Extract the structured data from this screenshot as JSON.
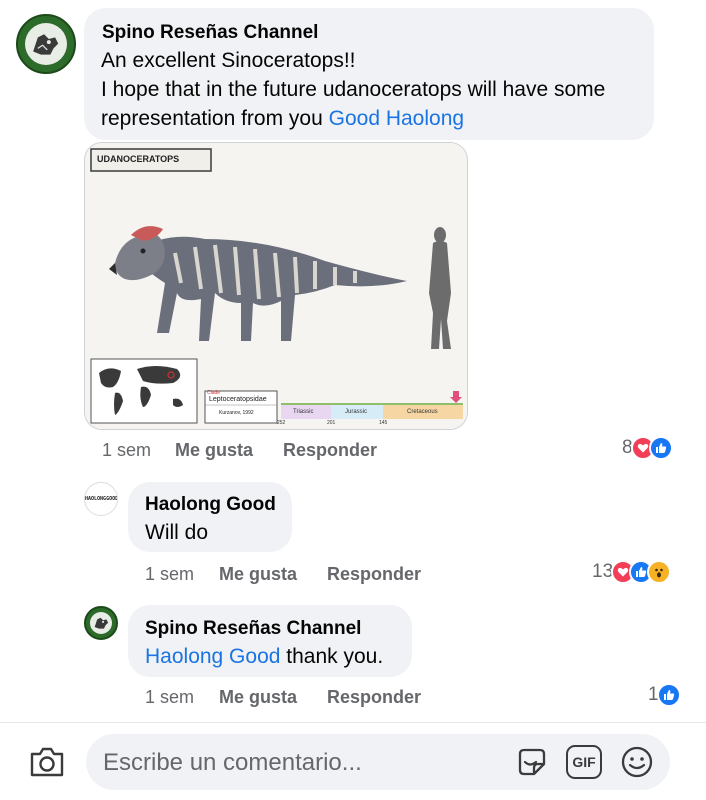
{
  "comments": [
    {
      "author": "Spino Reseñas Channel",
      "lines": [
        "An excellent Sinoceratops!!",
        "I hope that in the future udanoceratops will have some"
      ],
      "line3_prefix": "representation from you ",
      "line3_mention": "Good Haolong",
      "time": "1 sem",
      "like_label": "Me gusta",
      "reply_label": "Responder",
      "reaction_count": "8",
      "reaction_types": [
        "love",
        "like"
      ]
    },
    {
      "author": "Haolong Good",
      "avatar_text": "HAOLONGGOOD",
      "text": "Will do",
      "time": "1 sem",
      "like_label": "Me gusta",
      "reply_label": "Responder",
      "reaction_count": "13",
      "reaction_types": [
        "love",
        "like",
        "wow"
      ]
    },
    {
      "author": "Spino Reseñas Channel",
      "mention": "Haolong Good",
      "text_suffix": " thank you.",
      "time": "1 sem",
      "like_label": "Me gusta",
      "reply_label": "Responder",
      "reaction_count": "1",
      "reaction_types": [
        "like"
      ]
    }
  ],
  "attachment": {
    "title": "UDANOCERATOPS",
    "clade_label": "Clade",
    "clade": "Leptoceratopsidae",
    "author_year": "Kurzanov, 1992",
    "periods": [
      "Triassic",
      "Jurassic",
      "Cretaceous"
    ],
    "ticks": [
      "252",
      "201",
      "145"
    ]
  },
  "composer": {
    "placeholder": "Escribe un comentario...",
    "gif_label": "GIF"
  },
  "colors": {
    "mention": "#1b74e4",
    "bubble": "#f0f2f5",
    "meta": "#65676b",
    "love": "#f33e58",
    "like": "#1877f2",
    "wow": "#f7b125"
  }
}
